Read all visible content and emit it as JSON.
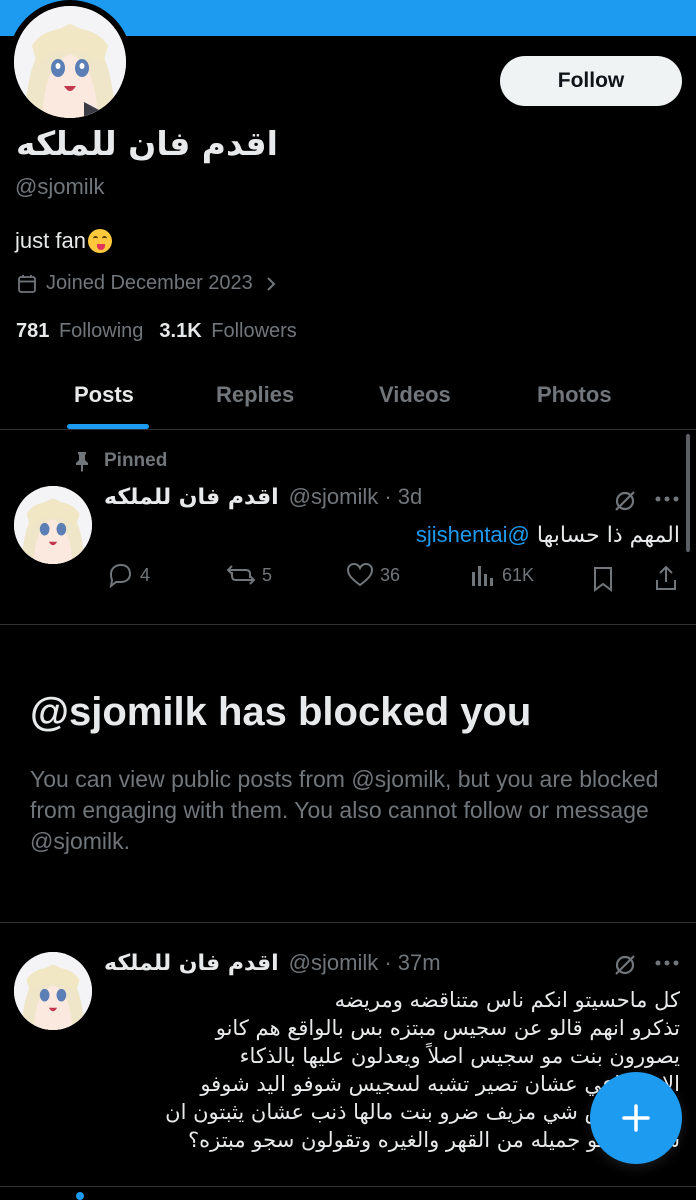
{
  "profile": {
    "display_name": "اقدم فان للملكه",
    "handle": "@sjomilk",
    "bio": "just fan",
    "bio_emoji": "face-savoring-food-emoji",
    "joined": "Joined December 2023",
    "following_count": "781",
    "following_label": "Following",
    "followers_count": "3.1K",
    "followers_label": "Followers",
    "follow_button": "Follow"
  },
  "tabs": [
    {
      "label": "Posts",
      "active": true
    },
    {
      "label": "Replies",
      "active": false
    },
    {
      "label": "Videos",
      "active": false
    },
    {
      "label": "Photos",
      "active": false
    }
  ],
  "pinned_post": {
    "pinned_label": "Pinned",
    "author_name": "اقدم فان للملكه",
    "author_meta": "@sjomilk · 3d",
    "text_prefix": "المهم ذا حسابها",
    "mention": "@sjishentai",
    "replies": "4",
    "reposts": "5",
    "likes": "36",
    "views": "61K"
  },
  "blocked": {
    "title": "@sjomilk has blocked you",
    "description": "You can view public posts from @sjomilk, but you are blocked from engaging with them. You also cannot follow or message @sjomilk."
  },
  "second_post": {
    "author_name": "اقدم فان للملكه",
    "author_meta": "@sjomilk · 37m",
    "lines": [
      "كل ماحسيتو انكم ناس متناقضه ومريضه",
      "تذكرو انهم قالو عن سجيس مبتزه بس بالواقع هم كانو",
      "يصورون بنت مو سجيس اصلاً ويعدلون عليها بالذكاء",
      "الاصطناعي عشان تصير تشبه لسجيس شوفو اليد شوفو",
      "الاثبات بس شي مزيف ضرو بنت مالها ذنب عشان يثبتون ان",
      "سجيس مو جميله من القهر والغيره وتقولون سجو مبتزه؟"
    ]
  },
  "colors": {
    "accent": "#1d9bf0",
    "background": "#000000",
    "text_primary": "#e7e9ea",
    "text_secondary": "#71767b"
  }
}
